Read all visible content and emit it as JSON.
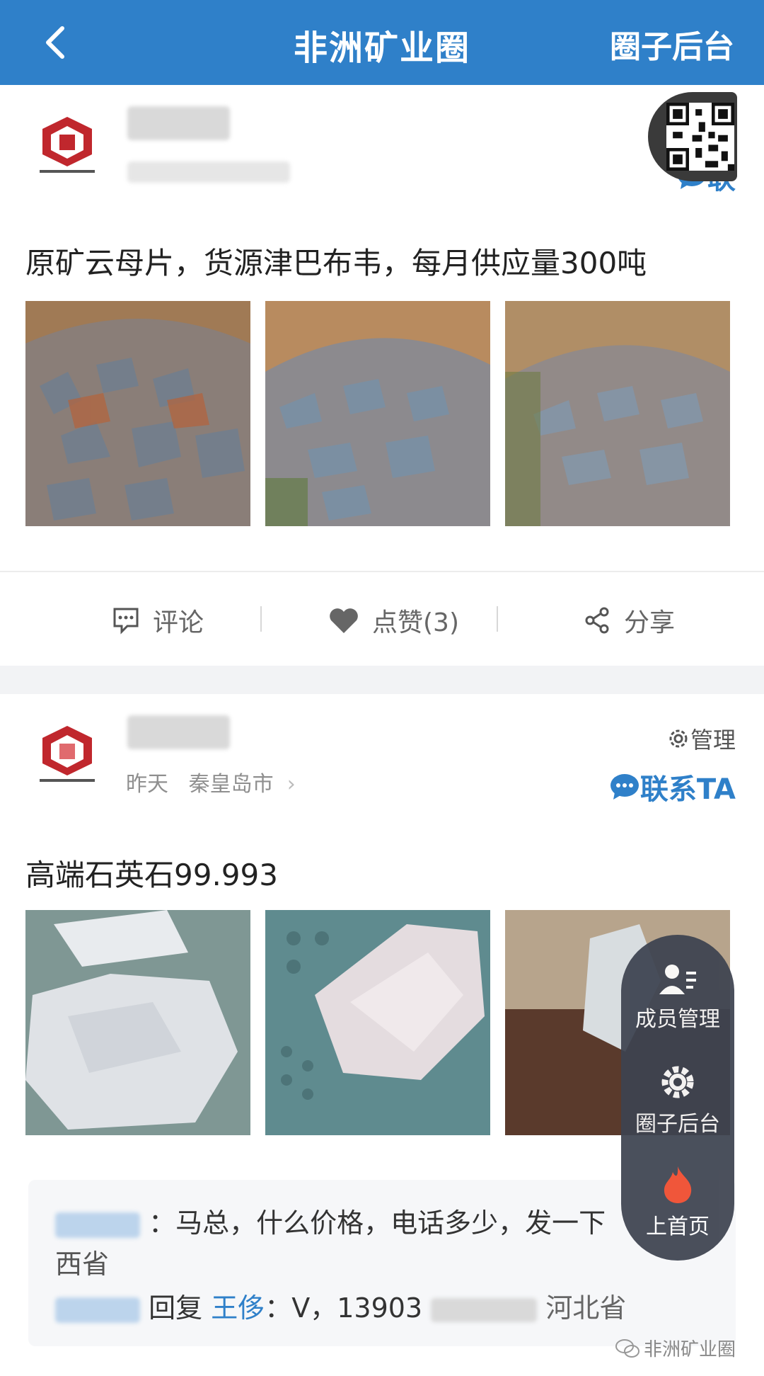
{
  "header": {
    "back_icon": "chevron-left-icon",
    "title": "非洲矿业圈",
    "admin_label": "圈子后台"
  },
  "post1": {
    "text": "原矿云母片，货源津巴布韦，每月供应量300吨",
    "contact_label": "联",
    "actions": {
      "comment": "评论",
      "like": "点赞(3)",
      "share": "分享"
    }
  },
  "post2": {
    "meta_time": "昨天",
    "meta_city": "秦皇岛市",
    "manage_label": "管理",
    "contact_label": "联系TA",
    "text": "高端石英石99.993",
    "comments": {
      "line1_text": "马总，什么价格，电话多少，发一下",
      "line1_cont": "西省",
      "line2_reply": "回复",
      "line2_name": "王侈",
      "line2_text": "V，13903",
      "line2_province": "河北省"
    }
  },
  "fab": {
    "members": "成员管理",
    "backend": "圈子后台",
    "top": "上首页"
  },
  "watermark": "非洲矿业圈",
  "colors": {
    "primary": "#2f80c9",
    "fab_bg": "#3d4350"
  }
}
